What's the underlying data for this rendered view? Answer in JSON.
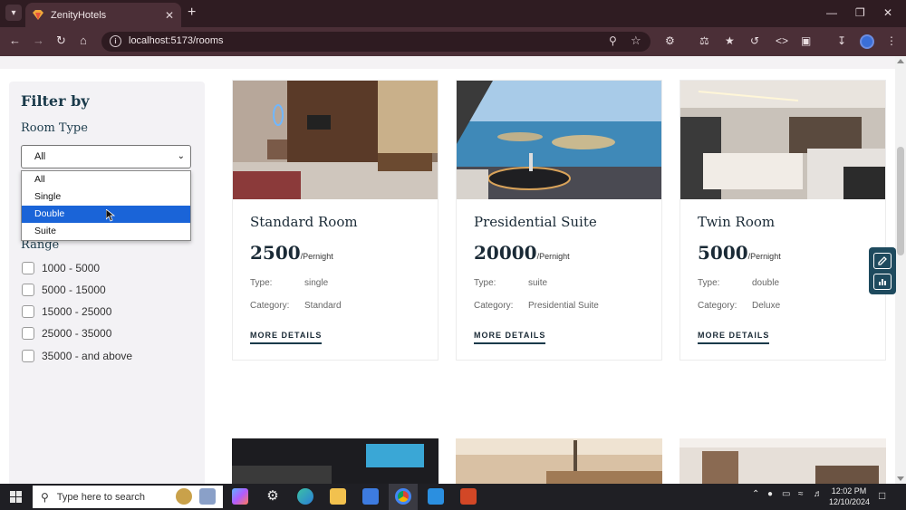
{
  "browser": {
    "tab_title": "ZenityHotels",
    "url": "localhost:5173/rooms"
  },
  "sidebar": {
    "title": "Filter by",
    "room_type_label": "Room Type",
    "select_value": "All",
    "options": [
      "All",
      "Single",
      "Double",
      "Suite"
    ],
    "highlighted_option": "Double",
    "range_label": "Range",
    "ranges": [
      "1000 - 5000",
      "5000 - 15000",
      "15000 - 25000",
      "25000 - 35000",
      "35000 - and above"
    ]
  },
  "rooms": [
    {
      "name": "Standard Room",
      "price": "2500",
      "unit": "/Pernight",
      "type_label": "Type:",
      "type": "single",
      "category_label": "Category:",
      "category": "Standard",
      "cta": "MORE DETAILS"
    },
    {
      "name": "Presidential Suite",
      "price": "20000",
      "unit": "/Pernight",
      "type_label": "Type:",
      "type": "suite",
      "category_label": "Category:",
      "category": "Presidential Suite",
      "cta": "MORE DETAILS"
    },
    {
      "name": "Twin Room",
      "price": "5000",
      "unit": "/Pernight",
      "type_label": "Type:",
      "type": "double",
      "category_label": "Category:",
      "category": "Deluxe",
      "cta": "MORE DETAILS"
    }
  ],
  "taskbar": {
    "search_placeholder": "Type here to search",
    "time": "12:02 PM",
    "date": "12/10/2024"
  },
  "colors": {
    "accent": "#1a3a4a",
    "selected_option": "#1a64d8",
    "browser_frame": "#4b2f37"
  }
}
